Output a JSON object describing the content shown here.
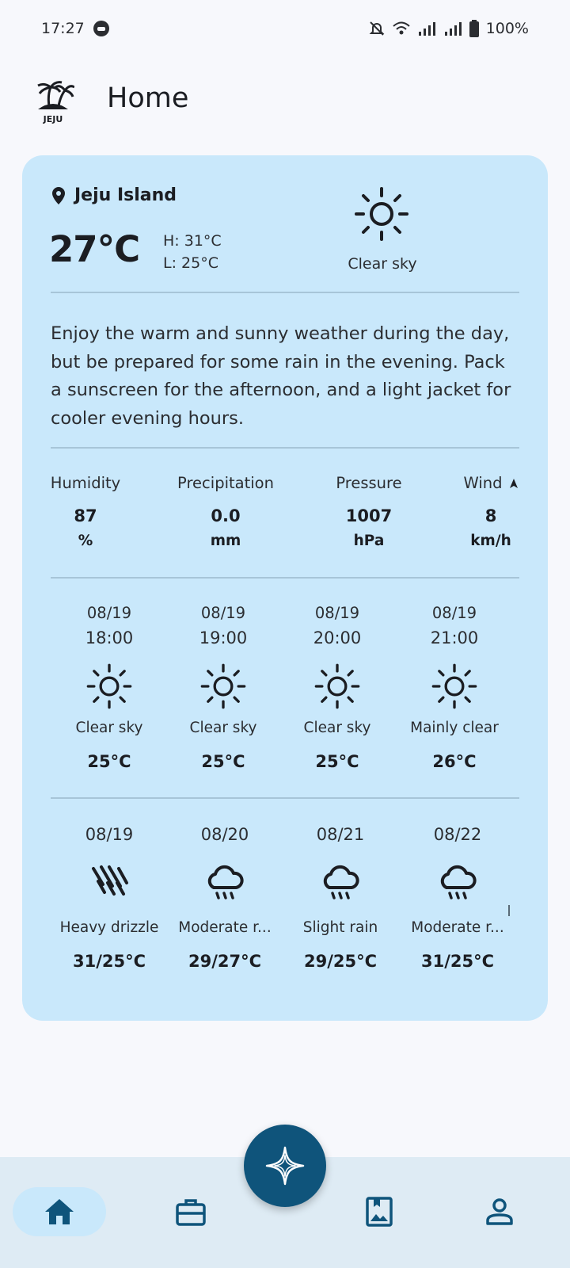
{
  "status_bar": {
    "time": "17:27",
    "battery": "100%"
  },
  "header": {
    "logo_text": "JEJU",
    "title": "Home"
  },
  "weather": {
    "location": "Jeju Island",
    "temperature": "27°C",
    "high": "H: 31°C",
    "low": "L: 25°C",
    "condition": "Clear sky",
    "summary": "Enjoy the warm and sunny weather during the day, but be prepared for some rain in the evening. Pack a sunscreen for the afternoon, and a light jacket for cooler evening hours.",
    "metrics": [
      {
        "label": "Humidity",
        "value": "87",
        "unit": "%"
      },
      {
        "label": "Precipitation",
        "value": "0.0",
        "unit": "mm"
      },
      {
        "label": "Pressure",
        "value": "1007",
        "unit": "hPa"
      },
      {
        "label": "Wind",
        "value": "8",
        "unit": "km/h"
      }
    ],
    "hourly": [
      {
        "date": "08/19",
        "time": "18:00",
        "icon": "sun-icon",
        "condition": "Clear sky",
        "temp": "25°C"
      },
      {
        "date": "08/19",
        "time": "19:00",
        "icon": "sun-icon",
        "condition": "Clear sky",
        "temp": "25°C"
      },
      {
        "date": "08/19",
        "time": "20:00",
        "icon": "sun-icon",
        "condition": "Clear sky",
        "temp": "25°C"
      },
      {
        "date": "08/19",
        "time": "21:00",
        "icon": "sun-icon",
        "condition": "Mainly clear",
        "temp": "26°C"
      }
    ],
    "daily": [
      {
        "date": "08/19",
        "icon": "drizzle-icon",
        "condition": "Heavy drizzle",
        "temp": "31/25°C"
      },
      {
        "date": "08/20",
        "icon": "rain-cloud-icon",
        "condition": "Moderate r...",
        "temp": "29/27°C"
      },
      {
        "date": "08/21",
        "icon": "rain-cloud-icon",
        "condition": "Slight rain",
        "temp": "29/25°C"
      },
      {
        "date": "08/22",
        "icon": "rain-cloud-icon",
        "condition": "Moderate r...",
        "temp": "31/25°C"
      }
    ]
  },
  "nav": {
    "items": [
      {
        "icon": "home-icon",
        "active": true
      },
      {
        "icon": "briefcase-icon",
        "active": false
      },
      {
        "icon": "bookmark-photo-icon",
        "active": false
      },
      {
        "icon": "profile-icon",
        "active": false
      }
    ],
    "fab_icon": "sparkle-icon"
  },
  "colors": {
    "card": "#c9e8fb",
    "accent": "#0f547b",
    "nav_bg": "#deebf4"
  }
}
